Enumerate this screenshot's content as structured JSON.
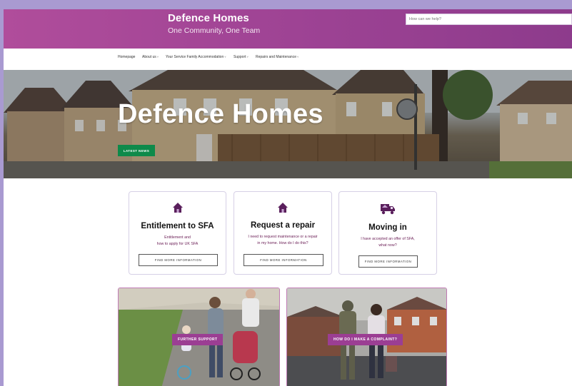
{
  "header": {
    "title": "Defence Homes",
    "tagline": "One Community, One Team",
    "search_placeholder": "How can we help?"
  },
  "nav": {
    "items": [
      {
        "label": "Homepage",
        "has_dropdown": false
      },
      {
        "label": "About us",
        "has_dropdown": true
      },
      {
        "label": "Your Service Family Accommodation",
        "has_dropdown": true
      },
      {
        "label": "Support",
        "has_dropdown": true
      },
      {
        "label": "Repairs and Maintenance",
        "has_dropdown": true
      }
    ],
    "caret": "˅"
  },
  "hero": {
    "title": "Defence Homes",
    "button": "LATEST NEWS"
  },
  "cards": [
    {
      "icon": "house-icon",
      "title": "Entitlement to SFA",
      "desc_line1": "Entitlement and",
      "desc_line2": "how to apply for UK SFA",
      "button": "FIND MORE INFORMATION"
    },
    {
      "icon": "house-icon",
      "title": "Request a repair",
      "desc_line1": "I need to request maintenance or a repair",
      "desc_line2": "in my home. How do I do this?",
      "button": "FIND MORE INFORMATION"
    },
    {
      "icon": "moving-truck-icon",
      "title": "Moving in",
      "desc_line1": "I have accepted an offer of SFA,",
      "desc_line2": "what now?",
      "button": "FIND MORE INFORMATION"
    }
  ],
  "tiles": [
    {
      "label": "FURTHER SUPPORT"
    },
    {
      "label": "HOW DO I MAKE A COMPLAINT?"
    }
  ],
  "colors": {
    "brand_purple": "#9b3e93",
    "header_gradient_start": "#b04d9b",
    "header_gradient_end": "#8d3b8c",
    "accent_green": "#0e8a4a",
    "card_text_purple": "#6a1d55",
    "icon_purple": "#5a1f5c",
    "page_background": "#a99ad1"
  }
}
